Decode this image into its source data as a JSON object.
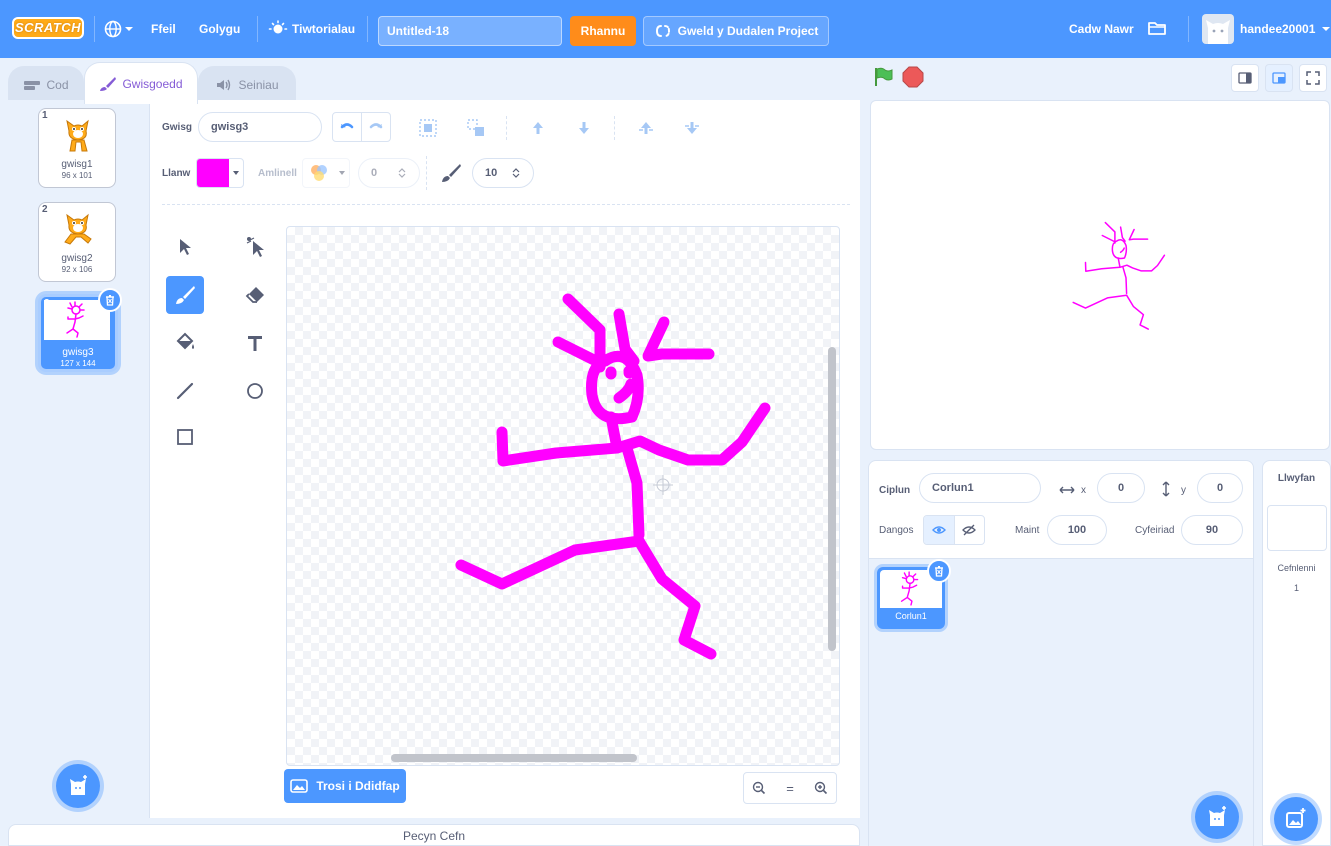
{
  "menu": {
    "logo": "SCRATCH",
    "file": "Ffeil",
    "edit": "Golygu",
    "tutorials": "Tiwtorialau",
    "project_title": "Untitled-18",
    "share": "Rhannu",
    "see_project_page": "Gweld y Dudalen Project",
    "save_now": "Cadw Nawr",
    "username": "handee20001"
  },
  "tabs": {
    "code": "Cod",
    "costumes": "Gwisgoedd",
    "sounds": "Seiniau"
  },
  "costumes": [
    {
      "number": "1",
      "name": "gwisg1",
      "size": "96 x 101"
    },
    {
      "number": "2",
      "name": "gwisg2",
      "size": "92 x 106"
    },
    {
      "number": "3",
      "name": "gwisg3",
      "size": "127 x 144"
    }
  ],
  "paint": {
    "costume_label": "Gwisg",
    "costume_name": "gwisg3",
    "fill_label": "Llanw",
    "fill_color": "#ff00ff",
    "outline_label": "Amlinell",
    "outline_width": "0",
    "brush_size": "10",
    "convert_button": "Trosi i Ddidfap",
    "zoom_reset": "="
  },
  "backpack": "Pecyn Cefn",
  "sprite": {
    "sprite_label": "Ciplun",
    "sprite_name": "Corlun1",
    "x_label": "x",
    "x": "0",
    "y_label": "y",
    "y": "0",
    "show_label": "Dangos",
    "size_label": "Maint",
    "size": "100",
    "direction_label": "Cyfeiriad",
    "direction": "90",
    "tile_name": "Corlun1"
  },
  "stage_pane": {
    "title": "Llwyfan",
    "backdrops_label": "Cefnlenni",
    "backdrops_count": "1"
  },
  "colors": {
    "accent": "#4c97ff",
    "menu_bg": "#4c97ff",
    "share": "#ff8c1a",
    "drawing": "#ff00ff",
    "costume_tab_text": "#855cd6"
  }
}
